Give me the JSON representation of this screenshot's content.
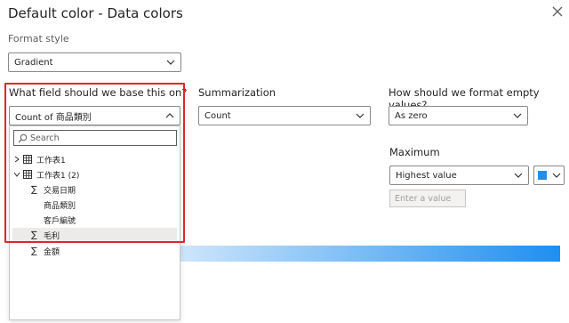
{
  "dialog": {
    "title": "Default color - Data colors"
  },
  "format_style": {
    "label": "Format style",
    "value": "Gradient"
  },
  "base_field": {
    "label": "What field should we base this on?",
    "value": "Count of 商品類別",
    "search_placeholder": "Search",
    "tree": [
      {
        "label": "工作表1",
        "expanded": false
      },
      {
        "label": "工作表1 (2)",
        "expanded": true
      },
      {
        "label": "交易日期",
        "sigma": true
      },
      {
        "label": "商品類別",
        "sigma": false
      },
      {
        "label": "客戶編號",
        "sigma": false
      },
      {
        "label": "毛利",
        "sigma": true,
        "selected": true
      },
      {
        "label": "金額",
        "sigma": true
      }
    ]
  },
  "summarization": {
    "label": "Summarization",
    "value": "Count"
  },
  "empty_values": {
    "label": "How should we format empty values?",
    "value": "As zero"
  },
  "maximum": {
    "label": "Maximum",
    "value": "Highest value",
    "placeholder": "Enter a value",
    "color": "#1E8FF0"
  },
  "colors": {
    "highlight": "#E0262B",
    "gradient_start": "#CFE6FB",
    "gradient_end": "#1E8FF0"
  }
}
